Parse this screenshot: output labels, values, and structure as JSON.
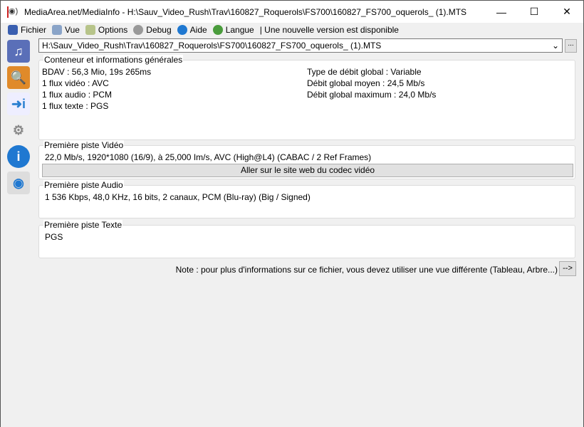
{
  "window": {
    "title": "MediaArea.net/MediaInfo - H:\\Sauv_Video_Rush\\Trav\\160827_Roquerols\\FS700\\160827_FS700_oquerols_ (1).MTS",
    "minimize": "—",
    "maximize": "☐",
    "close": "✕"
  },
  "menu": [
    {
      "label": "Fichier",
      "color": "#3a5fb0"
    },
    {
      "label": "Vue",
      "color": "#8aa4c8"
    },
    {
      "label": "Options",
      "color": "#b7c48a"
    },
    {
      "label": "Debug",
      "color": "#999"
    },
    {
      "label": "Aide",
      "color": "#1f78d1"
    },
    {
      "label": "Langue",
      "color": "#4a9c3c"
    }
  ],
  "update_notice": "| Une nouvelle version est disponible",
  "file": {
    "path": "H:\\Sauv_Video_Rush\\Trav\\160827_Roquerols\\FS700\\160827_FS700_oquerols_ (1).MTS",
    "browse": "..."
  },
  "general": {
    "legend": "Conteneur et informations générales",
    "left": [
      "BDAV : 56,3 Mio, 19s 265ms",
      "1 flux vidéo : AVC",
      "1 flux audio : PCM",
      "1 flux texte : PGS"
    ],
    "right": [
      "Type de débit global : Variable",
      "Débit global moyen : 24,5 Mb/s",
      "Débit global maximum : 24,0 Mb/s"
    ]
  },
  "video": {
    "legend": "Première piste Vidéo",
    "text": "22,0 Mb/s, 1920*1080 (16/9), à 25,000 Im/s, AVC (High@L4) (CABAC / 2 Ref Frames)",
    "button": "Aller sur le site web du codec vidéo"
  },
  "audio": {
    "legend": "Première piste Audio",
    "text": "1 536 Kbps, 48,0 KHz, 16 bits, 2 canaux, PCM (Blu-ray) (Big / Signed)"
  },
  "texte": {
    "legend": "Première piste Texte",
    "text": "PGS"
  },
  "note": {
    "text": "Note : pour plus d'informations sur ce fichier, vous devez utiliser une vue différente (Tableau, Arbre...)",
    "button": "-->"
  }
}
